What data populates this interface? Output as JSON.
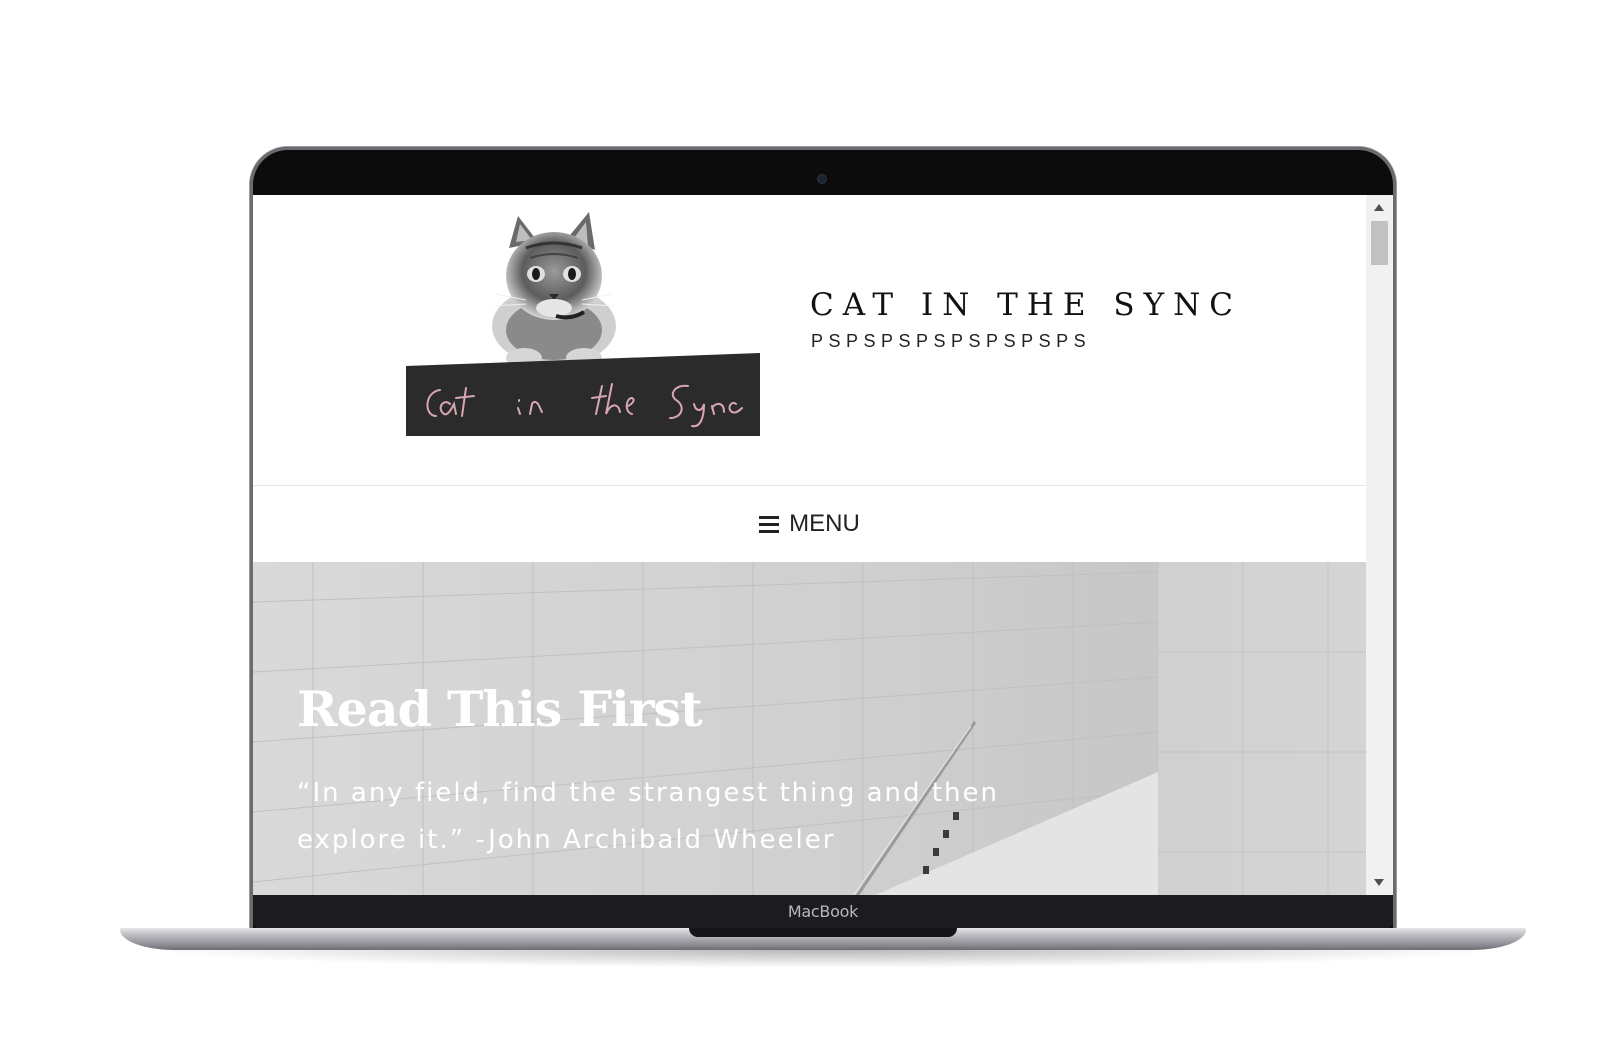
{
  "device": {
    "brand_label": "MacBook"
  },
  "site": {
    "title": "CAT IN THE SYNC",
    "tagline": "PSPSPSPSPSPSPSPS",
    "logo": {
      "icon": "cat-logo-icon",
      "caption": "Cat in the Sync"
    }
  },
  "nav": {
    "menu_icon": "hamburger-icon",
    "menu_label": "MENU"
  },
  "hero": {
    "title": "Read This First",
    "quote": "“In any field, find the strangest thing and then explore it.” -John Archibald Wheeler"
  },
  "colors": {
    "hero_text": "#ffffff",
    "title_text": "#111111",
    "logo_banner": "#2b2b2b",
    "logo_script": "#d9a6b2"
  }
}
